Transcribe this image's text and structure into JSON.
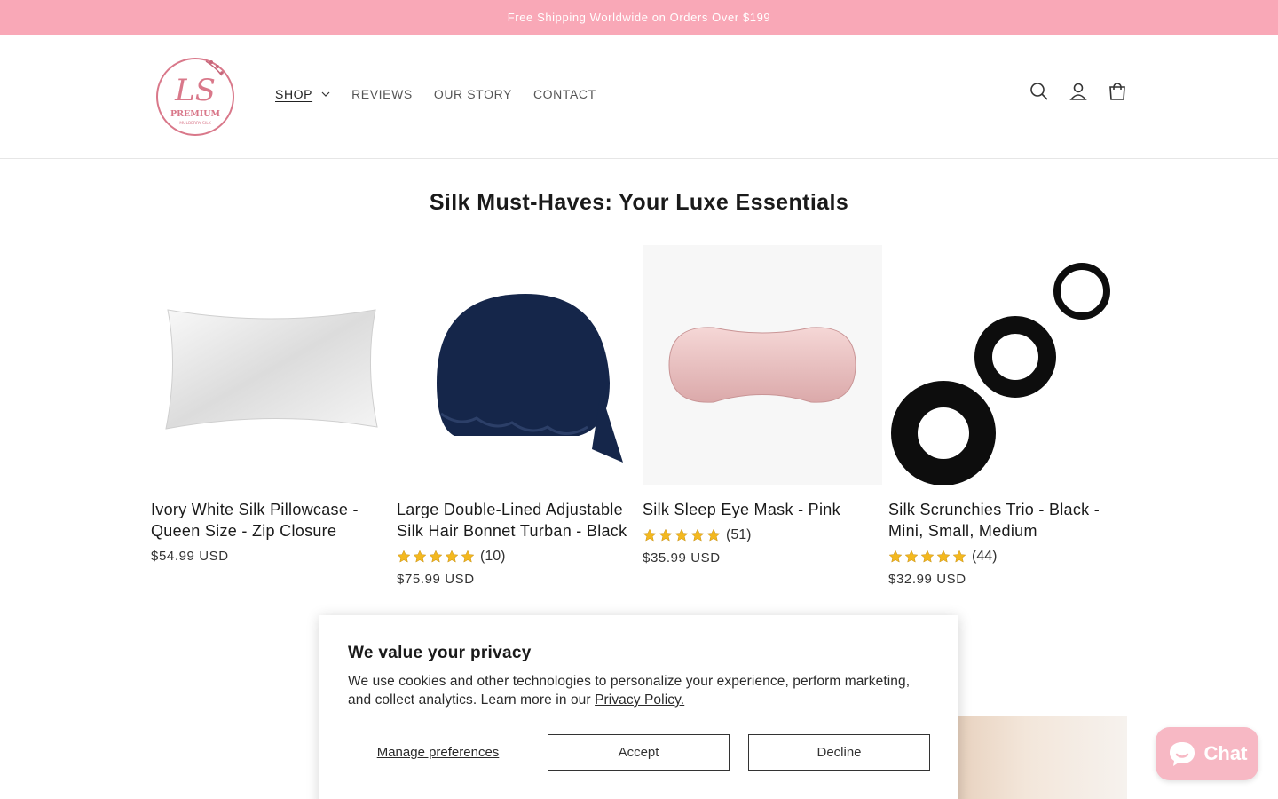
{
  "announcement": "Free Shipping Worldwide on Orders Over $199",
  "logo": {
    "initials": "LS",
    "line1": "PREMIUM",
    "line2": "MULBERRY SILK"
  },
  "nav": [
    {
      "label": "SHOP"
    },
    {
      "label": "REVIEWS"
    },
    {
      "label": "OUR STORY"
    },
    {
      "label": "CONTACT"
    }
  ],
  "header_icons": [
    "search-icon",
    "account-icon",
    "cart-icon"
  ],
  "section_title": "Silk Must-Haves: Your Luxe Essentials",
  "products": [
    {
      "title": "Ivory White Silk Pillowcase - Queen Size - Zip Closure",
      "rating": null,
      "reviews": "",
      "price": "$54.99 USD"
    },
    {
      "title": "Large Double-Lined Adjustable Silk Hair Bonnet Turban - Black",
      "rating": 5,
      "reviews": "(10)",
      "price": "$75.99 USD"
    },
    {
      "title": "Silk Sleep Eye Mask - Pink",
      "rating": 5,
      "reviews": "(51)",
      "price": "$35.99 USD"
    },
    {
      "title": "Silk Scrunchies Trio - Black - Mini, Small, Medium",
      "rating": 5,
      "reviews": "(44)",
      "price": "$32.99 USD"
    }
  ],
  "cookie": {
    "heading": "We value your privacy",
    "text": "We use cookies and other technologies to personalize your experience, perform marketing, and collect analytics. Learn more in our ",
    "link": "Privacy Policy.",
    "manage": "Manage preferences",
    "accept": "Accept",
    "decline": "Decline"
  },
  "chat": {
    "label": "Chat"
  },
  "colors": {
    "announcement_bg": "#f9a8b7",
    "brand_pink": "#d9788a",
    "star": "#f3b81f",
    "chat_bg": "#f7b8c4"
  }
}
